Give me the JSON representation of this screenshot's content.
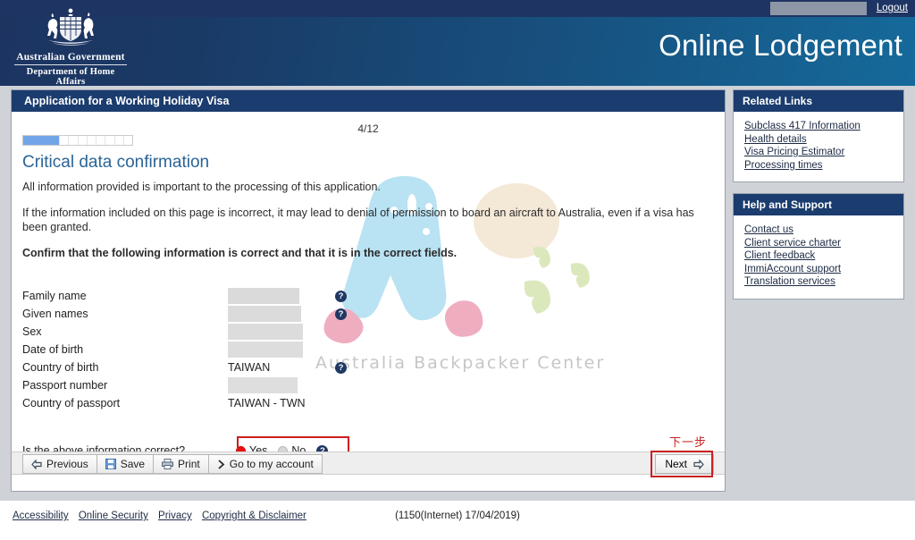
{
  "header": {
    "logout_label": "Logout",
    "app_title": "Online Lodgement",
    "crest_line1": "Australian Government",
    "crest_line2": "Department of Home Affairs"
  },
  "panel": {
    "title": "Application for a Working Holiday Visa",
    "page_counter": "4/12",
    "progress_percent": 33,
    "section_title": "Critical data confirmation",
    "paragraph1": "All information provided is important to the processing of this application.",
    "paragraph2": "If the information included on this page is incorrect, it may lead to denial of permission to board an aircraft to Australia, even if a visa has been granted.",
    "paragraph3": "Confirm that the following information is correct and that it is in the correct fields."
  },
  "watermark": {
    "text": "Australia Backpacker Center",
    "colors": {
      "body": "#b9e2f2",
      "feet": "#efaec0",
      "blob": "#f0e0c8",
      "leaf": "#dbe8bc",
      "text": "#c6c6c6"
    }
  },
  "fields": [
    {
      "label": "Family name",
      "value": "",
      "redacted": true,
      "help": true
    },
    {
      "label": "Given names",
      "value": "",
      "redacted": true,
      "help": true
    },
    {
      "label": "Sex",
      "value": "",
      "redacted": true,
      "help": false
    },
    {
      "label": "Date of birth",
      "value": "",
      "redacted": true,
      "help": false
    },
    {
      "label": "Country of birth",
      "value": "TAIWAN",
      "redacted": false,
      "help": true
    },
    {
      "label": "Passport number",
      "value": "",
      "redacted": true,
      "help": false
    },
    {
      "label": "Country of passport",
      "value": "TAIWAN - TWN",
      "redacted": false,
      "help": false
    }
  ],
  "confirm": {
    "question": "Is the above information correct?",
    "yes_label": "Yes",
    "no_label": "No",
    "selected": "Yes",
    "help": true,
    "annotation_color": "#cc1f1f"
  },
  "toolbar": {
    "buttons": [
      {
        "label": "Previous",
        "icon": "arrow-left-icon"
      },
      {
        "label": "Save",
        "icon": "floppy-disk-icon"
      },
      {
        "label": "Print",
        "icon": "printer-icon"
      },
      {
        "label": "Go to my account",
        "icon": "chevron-right-icon"
      }
    ],
    "next_label": "Next",
    "next_annotation": "下一步"
  },
  "sidebar": {
    "related": {
      "title": "Related Links",
      "links": [
        "Subclass 417 Information",
        "Health details",
        "Visa Pricing Estimator",
        "Processing times"
      ]
    },
    "help": {
      "title": "Help and Support",
      "links": [
        "Contact us",
        "Client service charter",
        "Client feedback",
        "ImmiAccount support",
        "Translation services"
      ]
    }
  },
  "footer": {
    "links": [
      "Accessibility",
      "Online Security",
      "Privacy",
      "Copyright & Disclaimer"
    ],
    "version": "(1150(Internet) 17/04/2019)"
  },
  "theme": {
    "header_dark": "#1d3461",
    "header_light": "#156a9b",
    "panel_header": "#1b3c6e",
    "link": "#1d2b45",
    "heading": "#2a6496",
    "progress": "#72a5e8",
    "annotation": "#cc1f1f"
  }
}
